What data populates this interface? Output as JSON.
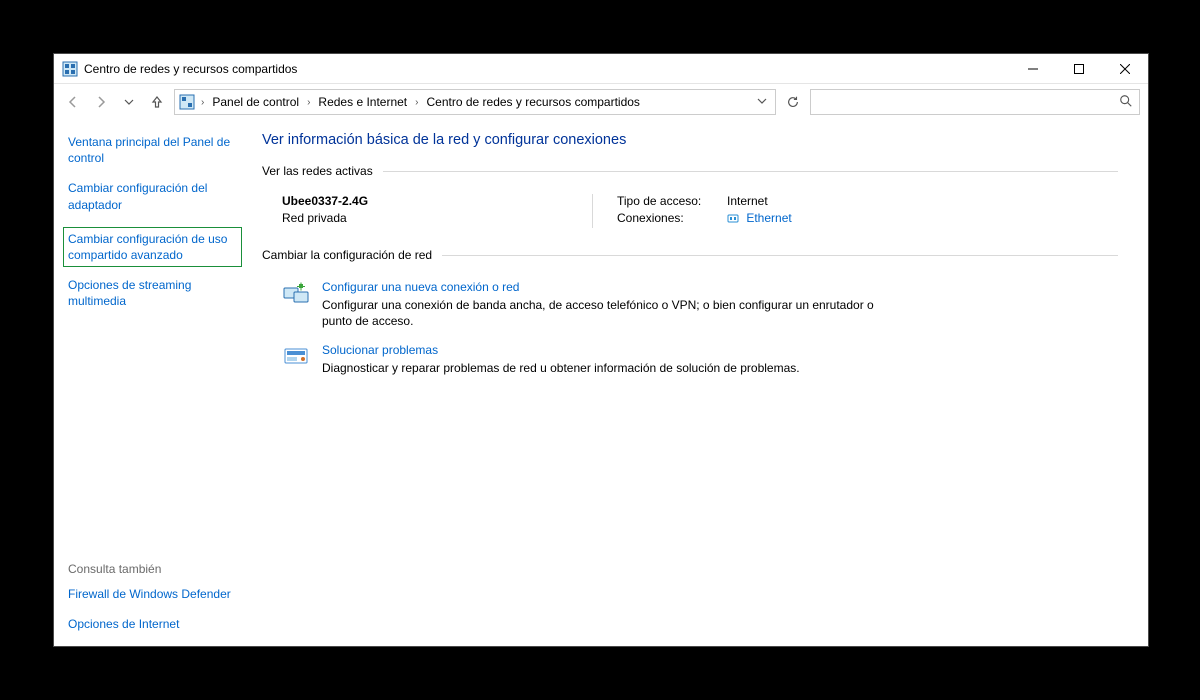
{
  "window": {
    "title": "Centro de redes y recursos compartidos"
  },
  "breadcrumb": {
    "root": "Panel de control",
    "mid": "Redes e Internet",
    "leaf": "Centro de redes y recursos compartidos"
  },
  "search": {
    "placeholder": ""
  },
  "sidebar": {
    "home": "Ventana principal del Panel de control",
    "adapter": "Cambiar configuración del adaptador",
    "sharing": "Cambiar configuración de uso compartido avanzado",
    "streaming": "Opciones de streaming multimedia",
    "see_also": "Consulta también",
    "firewall": "Firewall de Windows Defender",
    "inetopt": "Opciones de Internet"
  },
  "content": {
    "title": "Ver información básica de la red y configurar conexiones",
    "active_label": "Ver las redes activas",
    "network": {
      "name": "Ubee0337-2.4G",
      "type": "Red privada",
      "access_label": "Tipo de acceso:",
      "access_value": "Internet",
      "conn_label": "Conexiones:",
      "conn_link": "Ethernet"
    },
    "change_label": "Cambiar la configuración de red",
    "task1": {
      "title": "Configurar una nueva conexión o red",
      "desc": "Configurar una conexión de banda ancha, de acceso telefónico o VPN; o bien configurar un enrutador o punto de acceso."
    },
    "task2": {
      "title": "Solucionar problemas",
      "desc": "Diagnosticar y reparar problemas de red u obtener información de solución de problemas."
    }
  }
}
